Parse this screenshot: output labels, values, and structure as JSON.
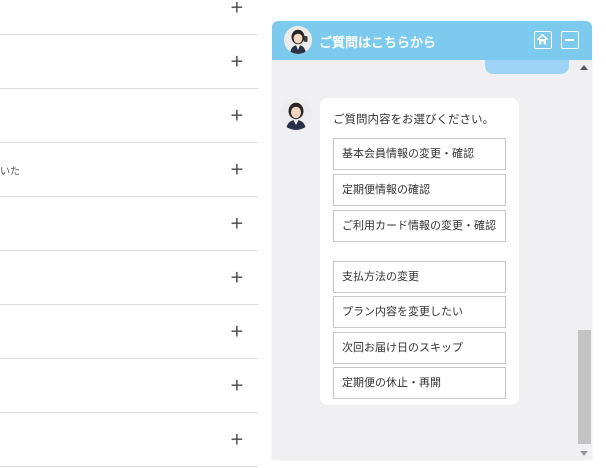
{
  "faq": {
    "rows": [
      {
        "text": "",
        "icon": "plus-icon"
      },
      {
        "text": "",
        "icon": "plus-icon"
      },
      {
        "text": "",
        "icon": "plus-icon"
      },
      {
        "text": "いた",
        "icon": "plus-icon"
      },
      {
        "text": "",
        "icon": "plus-icon"
      },
      {
        "text": "",
        "icon": "plus-icon"
      },
      {
        "text": "",
        "icon": "plus-icon"
      },
      {
        "text": "",
        "icon": "plus-icon"
      },
      {
        "text": "",
        "icon": "plus-icon"
      }
    ],
    "plus_symbol": "+"
  },
  "chat": {
    "header_title": "ご質問はこちらから",
    "header_color": "#7ccbee",
    "home_icon": "home-icon",
    "minimize_icon": "minimize-icon",
    "prompt": "ご質問内容をお選びください。",
    "options": [
      "基本会員情報の変更・確認",
      "定期便情報の確認",
      "ご利用カード情報の変更・確認",
      "支払方法の変更",
      "プラン内容を変更したい",
      "次回お届け日のスキップ",
      "定期便の休止・再開"
    ]
  }
}
